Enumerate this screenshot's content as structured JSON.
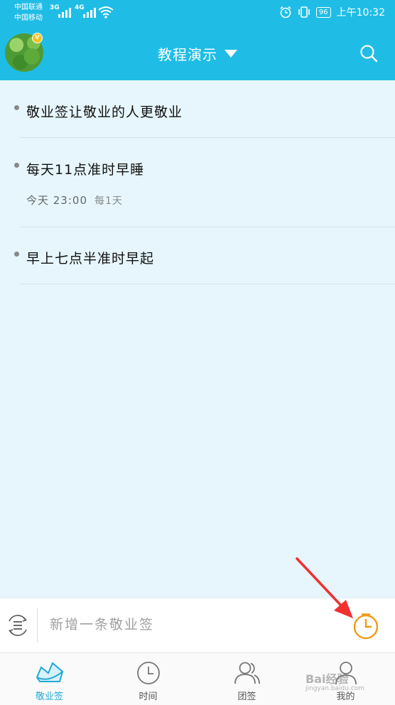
{
  "status_bar": {
    "carrier1": "中国联通",
    "carrier2": "中国移动",
    "net1": "3G",
    "net2": "4G",
    "battery": "96",
    "time": "上午10:32"
  },
  "header": {
    "title": "教程演示",
    "avatar_badge": "V"
  },
  "notes": [
    {
      "text": "敬业签让敬业的人更敬业"
    },
    {
      "text": "每天11点准时早睡",
      "time": "今天  23:00",
      "repeat": "每1天"
    },
    {
      "text": "早上七点半准时早起"
    }
  ],
  "input_bar": {
    "placeholder": "新增一条敬业签"
  },
  "tabs": [
    {
      "label": "敬业签",
      "icon": "note-icon",
      "active": true
    },
    {
      "label": "时间",
      "icon": "clock-icon",
      "active": false
    },
    {
      "label": "团签",
      "icon": "group-icon",
      "active": false
    },
    {
      "label": "我的",
      "icon": "person-icon",
      "active": false
    }
  ],
  "watermark": {
    "brand": "Bai经验",
    "url": "jingyan.baidu.com"
  },
  "colors": {
    "brand": "#1fbde6",
    "background": "#e6f6fc",
    "clock_accent": "#ef9a14",
    "arrow": "#f03030"
  }
}
